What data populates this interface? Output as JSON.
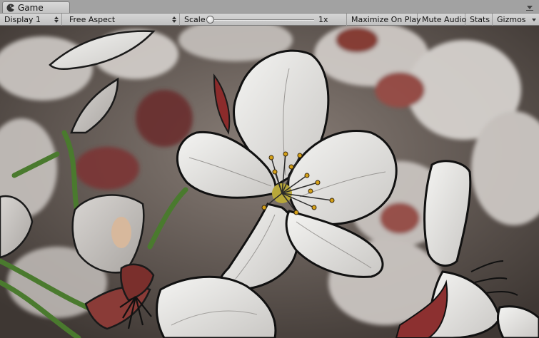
{
  "tab": {
    "title": "Game",
    "icon": "pacman-game-icon"
  },
  "toolbar": {
    "display_select": "Display 1",
    "aspect_select": "Free Aspect",
    "scale_label": "Scale",
    "scale_value": "1x",
    "scale_slider_fraction": 0.0,
    "maximize_on_play": "Maximize On Play",
    "mute_audio": "Mute Audio",
    "stats": "Stats",
    "gizmos": "Gizmos"
  },
  "colors": {
    "editor_bg": "#a2a2a2",
    "toolbar_bg": "#c8c8c8",
    "petal": "#e8e8e6",
    "petal_outline": "#1a1a1a",
    "stamen": "#d4a017",
    "dark_red": "#7a2c2c",
    "leaf_green": "#4a7a2e"
  },
  "viewport": {
    "content": "game-view-render"
  }
}
